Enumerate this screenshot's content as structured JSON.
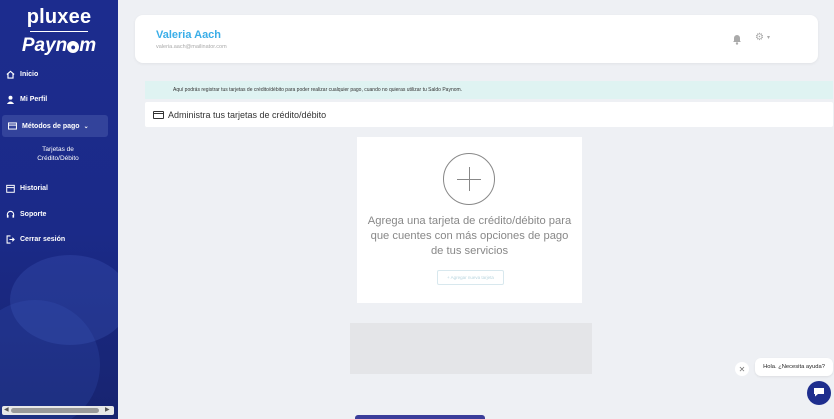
{
  "brand": {
    "name": "pluxee",
    "product": "Payn",
    "product_accent": "m"
  },
  "sidebar": {
    "items": [
      {
        "label": "Inicio",
        "icon": "home-icon"
      },
      {
        "label": "Mi Perfil",
        "icon": "user-icon"
      },
      {
        "label": "Métodos de pago",
        "icon": "card-icon",
        "expanded": true
      },
      {
        "label": "Historial",
        "icon": "calendar-icon"
      },
      {
        "label": "Soporte",
        "icon": "headset-icon"
      },
      {
        "label": "Cerrar sesión",
        "icon": "logout-icon"
      }
    ],
    "sub_item": {
      "line1": "Tarjetas de",
      "line2": "Crédito/Débito"
    }
  },
  "header": {
    "user_name": "Valeria Aach",
    "user_email": "valeria.aach@mailinator.com"
  },
  "info_banner": "Aquí podrás registrar tus tarjetas de crédito/débito para poder realizar cualquier pago, cuando no quieras utilizar tu Saldo Paynom.",
  "section_title": "Administra tus tarjetas de crédito/débito",
  "empty_state": {
    "line1": "Agrega una tarjeta de crédito/débito para",
    "line2": "que cuentes con más opciones de pago",
    "line3": "de tus servicios",
    "button": "+ Agregar nueva tarjeta"
  },
  "help": {
    "bubble": "Hola. ¿Necesita ayuda?"
  },
  "colors": {
    "sidebar": "#1c2c8e",
    "accent": "#3aaee8",
    "banner": "#dff3f2"
  }
}
